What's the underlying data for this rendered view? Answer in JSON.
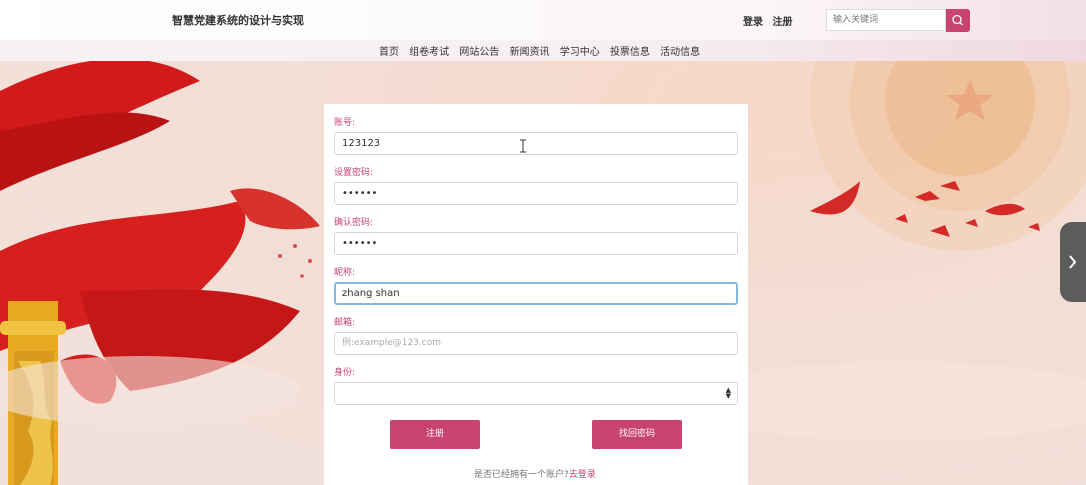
{
  "header": {
    "site_title": "智慧党建系统的设计与实现",
    "login_label": "登录",
    "register_label": "注册",
    "search_placeholder": "输入关键词",
    "search_icon": "search-icon",
    "accent_color": "#c8436d"
  },
  "nav": {
    "items": [
      "首页",
      "组卷考试",
      "网站公告",
      "新闻资讯",
      "学习中心",
      "投票信息",
      "活动信息"
    ]
  },
  "form": {
    "account_label": "账号:",
    "account_value": "123123",
    "password_label": "设置密码:",
    "password_value": "••••••",
    "confirm_label": "确认密码:",
    "confirm_value": "••••••",
    "nickname_label": "昵称:",
    "nickname_value": "zhang shan",
    "email_label": "邮箱:",
    "email_placeholder": "例:example@123.com",
    "identity_label": "身份:",
    "identity_value": "",
    "register_button": "注册",
    "recover_button": "找回密码",
    "footer_text": "是否已经拥有一个账户?",
    "footer_link": "去登录"
  }
}
